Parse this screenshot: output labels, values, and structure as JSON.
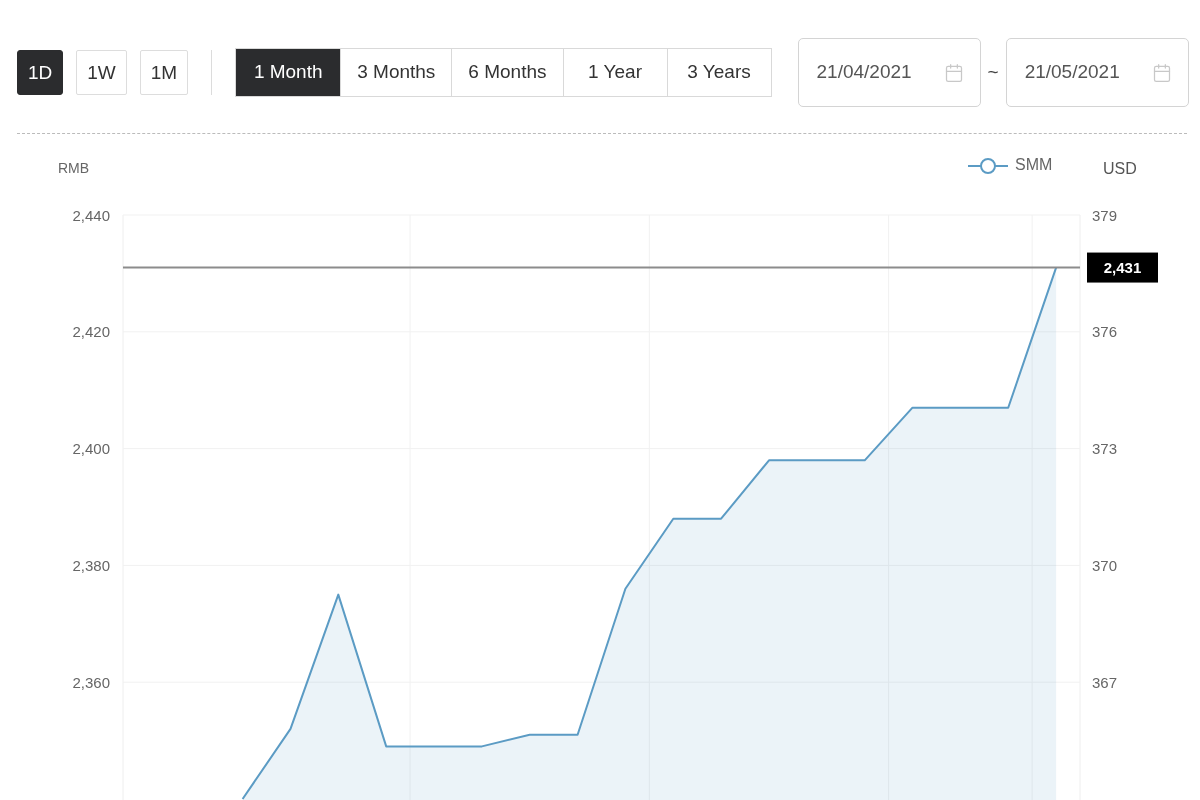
{
  "toolbar": {
    "range_buttons": [
      {
        "label": "1D",
        "selected": true
      },
      {
        "label": "1W",
        "selected": false
      },
      {
        "label": "1M",
        "selected": false
      }
    ],
    "period_tabs": [
      {
        "label": "1 Month",
        "selected": true
      },
      {
        "label": "3 Months",
        "selected": false
      },
      {
        "label": "6 Months",
        "selected": false
      },
      {
        "label": "1 Year",
        "selected": false
      },
      {
        "label": "3 Years",
        "selected": false
      }
    ],
    "date_range": {
      "start": "21/04/2021",
      "separator": "~",
      "end": "21/05/2021"
    }
  },
  "chart": {
    "usd_axis": {
      "label": "USD",
      "ticks": [
        "379",
        "376",
        "373",
        "370",
        "367"
      ]
    },
    "chart_data": {
      "type": "area",
      "ylabel": "RMB",
      "series": [
        {
          "name": "SMM",
          "color": "#5b9bc4",
          "values": [
            null,
            null,
            2340,
            2352,
            2375,
            2349,
            2349,
            2349,
            2351,
            2351,
            2376,
            2388,
            2388,
            2398,
            2398,
            2398,
            2407,
            2407,
            2407,
            2431
          ]
        }
      ],
      "ylim": [
        2340,
        2440
      ],
      "yticks": [
        {
          "value": 2440,
          "label": "2,440"
        },
        {
          "value": 2420,
          "label": "2,420"
        },
        {
          "value": 2400,
          "label": "2,400"
        },
        {
          "value": 2380,
          "label": "2,380"
        },
        {
          "value": 2360,
          "label": "2,360"
        }
      ],
      "grid": true,
      "ref_lines": [
        {
          "axis": "y",
          "value": 2431,
          "label": "2,431"
        }
      ]
    }
  }
}
